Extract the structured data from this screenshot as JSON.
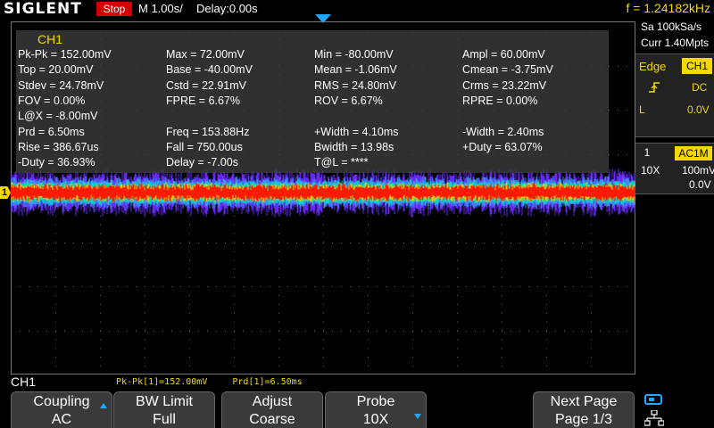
{
  "header": {
    "brand": "SIGLENT",
    "run_status": "Stop",
    "timebase": "M 1.00s/",
    "delay": "Delay:0.00s",
    "frequency": "f = 1.24182kHz"
  },
  "acquisition": {
    "sample_rate": "Sa 100kSa/s",
    "memory_depth": "Curr 1.40Mpts"
  },
  "trigger": {
    "type": "Edge",
    "source": "CH1",
    "slope_icon": "rising-edge-icon",
    "coupling": "DC",
    "mode": "L",
    "level": "0.0V"
  },
  "channel_info": {
    "number": "1",
    "coupling": "AC1M",
    "probe": "10X",
    "scale": "100mV/",
    "offset": "0.0V"
  },
  "measurements": {
    "title": "CH1",
    "rows": [
      [
        "Pk-Pk = 152.00mV",
        "Max = 72.00mV",
        "Min = -80.00mV",
        "Ampl = 60.00mV"
      ],
      [
        "Top = 20.00mV",
        "Base = -40.00mV",
        "Mean = -1.06mV",
        "Cmean = -3.75mV"
      ],
      [
        "Stdev = 24.78mV",
        "Cstd = 22.91mV",
        "RMS = 24.80mV",
        "Crms = 23.22mV"
      ],
      [
        "FOV = 0.00%",
        "FPRE = 6.67%",
        "ROV = 6.67%",
        "RPRE = 0.00%"
      ],
      [
        "L@X = -8.00mV",
        "",
        "",
        ""
      ],
      [
        "Prd = 6.50ms",
        "Freq = 153.88Hz",
        "+Width = 4.10ms",
        "-Width = 2.40ms"
      ],
      [
        "Rise = 386.67us",
        "Fall = 750.00us",
        "Bwidth = 13.98s",
        "+Duty = 63.07%"
      ],
      [
        "-Duty = 36.93%",
        "Delay = -7.00s",
        "T@L = ****",
        ""
      ]
    ]
  },
  "channel_marker": "1",
  "bottom": {
    "channel_label": "CH1",
    "measure_bar": [
      "Pk-Pk[1]=152.00mV",
      "Prd[1]=6.50ms"
    ]
  },
  "softkeys": {
    "coupling": {
      "title": "Coupling",
      "value": "AC"
    },
    "bwlimit": {
      "title": "BW Limit",
      "value": "Full"
    },
    "adjust": {
      "title": "Adjust",
      "value": "Coarse"
    },
    "probe": {
      "title": "Probe",
      "value": "10X"
    },
    "nextpage": {
      "title": "Next Page",
      "value": "Page 1/3"
    }
  },
  "colors": {
    "accent_yellow": "#f5d800",
    "accent_blue": "#1ea7ff",
    "stop_red": "#d00000",
    "trace_core": "#ff1a00",
    "trace_mid": "#00e0c0",
    "trace_outer": "#6a2cff"
  }
}
